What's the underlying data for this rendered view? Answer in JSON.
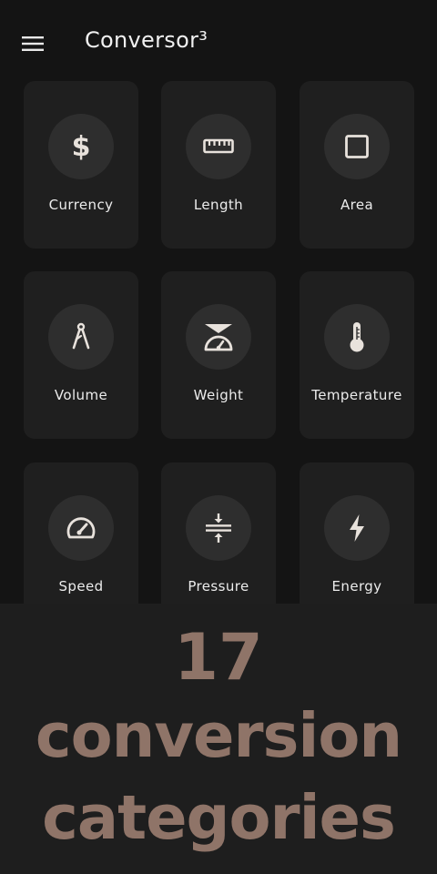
{
  "app": {
    "title": "Conversor³"
  },
  "colors": {
    "background": "#141414",
    "card": "#1f1f1f",
    "icon_circle": "#2e2e2e",
    "icon": "#e8e2dc",
    "promo_background": "#1e1e1e",
    "promo_text": "#8f7468"
  },
  "categories": [
    {
      "label": "Currency",
      "icon": "dollar-icon"
    },
    {
      "label": "Length",
      "icon": "ruler-icon"
    },
    {
      "label": "Area",
      "icon": "square-icon"
    },
    {
      "label": "Volume",
      "icon": "compass-icon"
    },
    {
      "label": "Weight",
      "icon": "scale-icon"
    },
    {
      "label": "Temperature",
      "icon": "thermometer-icon"
    },
    {
      "label": "Speed",
      "icon": "speedometer-icon"
    },
    {
      "label": "Pressure",
      "icon": "pressure-icon"
    },
    {
      "label": "Energy",
      "icon": "lightning-icon"
    }
  ],
  "promo": {
    "line1": "17",
    "line2": "conversion",
    "line3": "categories"
  }
}
